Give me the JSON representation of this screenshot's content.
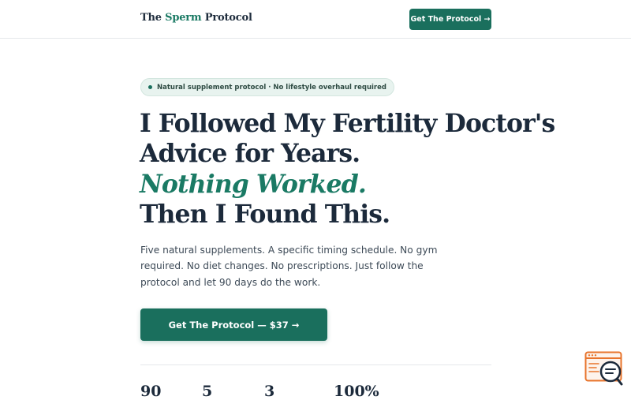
{
  "header": {
    "logo_part1": "The ",
    "logo_accent": "Sperm",
    "logo_part2": " Protocol",
    "cta_label": "Get The Protocol →"
  },
  "hero": {
    "badge_text": "Natural supplement protocol · No lifestyle overhaul required",
    "headline_line1": "I Followed My Fertility Doctor's",
    "headline_line2": "Advice for Years.",
    "headline_line3_italic": "Nothing Worked.",
    "headline_line4": "Then I Found This.",
    "subtext": "Five natural supplements. A specific timing schedule. No gym required. No diet changes. No prescriptions. Just follow the protocol and let 90 days do the work.",
    "cta_label": "Get The Protocol — $37 →"
  },
  "stats": [
    {
      "value": "90"
    },
    {
      "value": "5"
    },
    {
      "value": "3"
    },
    {
      "value": "100%"
    }
  ],
  "widgets": {
    "chat_icon": "chat-search-icon"
  },
  "colors": {
    "brand_green": "#1a6f5d",
    "accent_green": "#1a7a64",
    "heading_navy": "#1c2a3b",
    "widget_orange": "#e8742c"
  }
}
